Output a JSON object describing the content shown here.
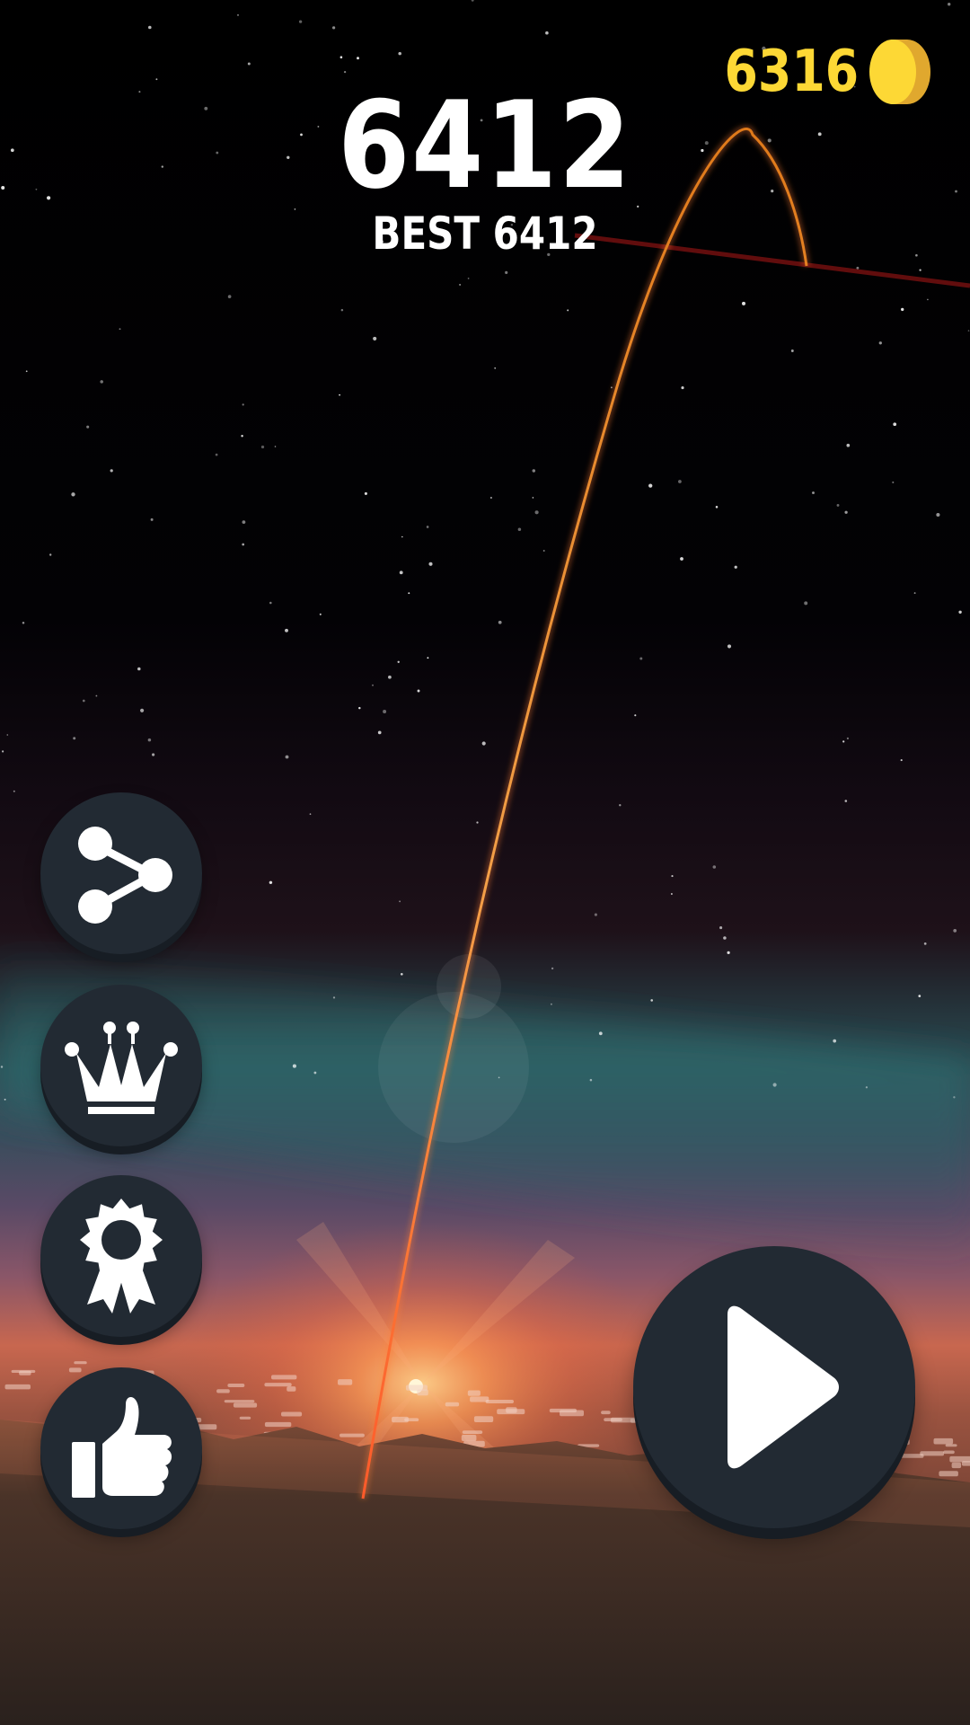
{
  "hud": {
    "score": "6412",
    "best_label": "BEST 6412",
    "coin_count": "6316"
  },
  "icons": {
    "coin": "coin-icon",
    "share": "share-icon",
    "leaderboard": "crown-icon",
    "achievements": "award-ribbon-icon",
    "rate": "thumbs-up-icon",
    "play": "play-icon"
  },
  "colors": {
    "score_text": "#ffffff",
    "coin_text": "#fdd835",
    "coin_face": "#fdd835",
    "coin_edge": "#e0a82e",
    "button_fill": "#222a33",
    "button_shadow": "#171d24",
    "trajectory": "#f08a2a",
    "sky_top": "#000000",
    "atmosphere_band": "#2e5a5e",
    "horizon_glow": "#f07a48"
  }
}
